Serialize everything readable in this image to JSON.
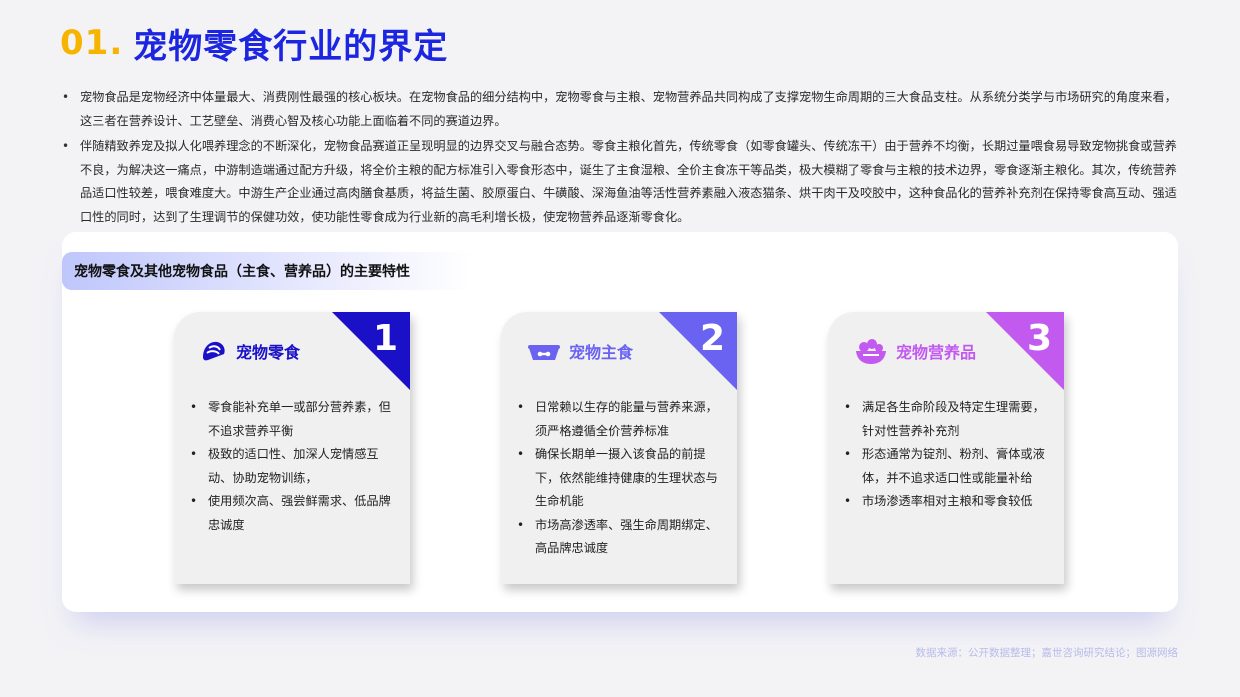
{
  "header": {
    "number": "01.",
    "title": "宠物零食行业的界定"
  },
  "intro": [
    "宠物食品是宠物经济中体量最大、消费刚性最强的核心板块。在宠物食品的细分结构中，宠物零食与主粮、宠物营养品共同构成了支撑宠物生命周期的三大食品支柱。从系统分类学与市场研究的角度来看，这三者在营养设计、工艺壁垒、消费心智及核心功能上面临着不同的赛道边界。",
    "伴随精致养宠及拟人化喂养理念的不断深化，宠物食品赛道正呈现明显的边界交叉与融合态势。零食主粮化首先，传统零食（如零食罐头、传统冻干）由于营养不均衡，长期过量喂食易导致宠物挑食或营养不良，为解决这一痛点，中游制造端通过配方升级，将全价主粮的配方标准引入零食形态中，诞生了主食湿粮、全价主食冻干等品类，极大模糊了零食与主粮的技术边界，零食逐渐主粮化。其次，传统营养品适口性较差，喂食难度大。中游生产企业通过高肉膳食基质，将益生菌、胶原蛋白、牛磺酸、深海鱼油等活性营养素融入液态猫条、烘干肉干及咬胶中，这种食品化的营养补充剂在保持零食高互动、强适口性的同时，达到了生理调节的保健功效，使功能性零食成为行业新的高毛利增长极，使宠物营养品逐渐零食化。"
  ],
  "panel": {
    "heading": "宠物零食及其他宠物食品（主食、营养品）的主要特性",
    "cards": [
      {
        "number": "1",
        "title": "宠物零食",
        "icon": "snack-bag-icon",
        "accent": "#1a10c8",
        "title_color": "#1a10c8",
        "items": [
          "零食能补充单一或部分营养素，但不追求营养平衡",
          "极致的适口性、加深人宠情感互动、协助宠物训练，",
          "使用频次高、强尝鲜需求、低品牌忠诚度"
        ]
      },
      {
        "number": "2",
        "title": "宠物主食",
        "icon": "pet-bowl-icon",
        "accent": "#6a63f2",
        "title_color": "#6a63f2",
        "items": [
          "日常赖以生存的能量与营养来源，须严格遵循全价营养标准",
          "确保长期单一摄入该食品的前提下，依然能维持健康的生理状态与生命机能",
          "市场高渗透率、强生命周期绑定、高品牌忠诚度"
        ]
      },
      {
        "number": "3",
        "title": "宠物营养品",
        "icon": "supplement-bowl-icon",
        "accent": "#c25af0",
        "title_color": "#c25af0",
        "items": [
          "满足各生命阶段及特定生理需要，针对性营养补充剂",
          "形态通常为锭剂、粉剂、膏体或液体，并不追求适口性或能量补给",
          "市场渗透率相对主粮和零食较低"
        ]
      }
    ]
  },
  "source": "数据来源：公开数据整理；嘉世咨询研究结论；图源网络"
}
